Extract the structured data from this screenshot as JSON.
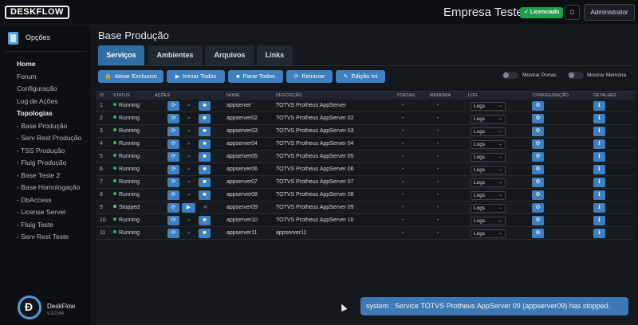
{
  "header": {
    "logo": "DESKFLOW",
    "company": "Empresa Teste",
    "license_badge": "✓ Licenciado",
    "user_button": "Administrator"
  },
  "sidebar": {
    "title": "Opções",
    "items": [
      {
        "label": "Home"
      },
      {
        "label": "Forum"
      },
      {
        "label": "Configuração"
      },
      {
        "label": "Log de Ações"
      },
      {
        "label": "Topologias"
      },
      {
        "label": "- Base Produção"
      },
      {
        "label": "- Serv Rest Produção"
      },
      {
        "label": "- TSS Produção"
      },
      {
        "label": "- Fluig Produção"
      },
      {
        "label": "- Base Teste 2"
      },
      {
        "label": "- Base Homologação"
      },
      {
        "label": "- DbAccess"
      },
      {
        "label": "- License Server"
      },
      {
        "label": "- Fluig Teste"
      },
      {
        "label": "- Serv Rest Teste"
      }
    ],
    "brand_name": "DeskFlow",
    "brand_version": "v.3.0.64"
  },
  "page": {
    "title": "Base Produção",
    "tabs": [
      "Serviços",
      "Ambientes",
      "Arquivos",
      "Links"
    ]
  },
  "actions": {
    "exclusive": "Ativar Exclusivo",
    "start_all": "Iniciar Todos",
    "stop_all": "Parar Todos",
    "restart": "Reiniciar",
    "edit_ini": "Edição Ini",
    "show_ports": "Mostrar Portas",
    "show_memory": "Mostrar Memória"
  },
  "table": {
    "headers": [
      "ID",
      "STATUS",
      "AÇÕES",
      "NOME",
      "DESCRIÇÃO",
      "PORTAS",
      "MEMÓRIA",
      "LOG",
      "CONFIGURAÇÃO",
      "DETALHES"
    ],
    "rows": [
      {
        "id": "1",
        "status": "Running",
        "name": "appserver",
        "desc": "TOTVS Protheus AppServer",
        "ports": "-",
        "memory": "-",
        "log": "Logs"
      },
      {
        "id": "2",
        "status": "Running",
        "name": "appserver02",
        "desc": "TOTVS Protheus AppServer 02",
        "ports": "-",
        "memory": "-",
        "log": "Logs"
      },
      {
        "id": "3",
        "status": "Running",
        "name": "appserver03",
        "desc": "TOTVS Protheus AppServer 03",
        "ports": "-",
        "memory": "-",
        "log": "Logs"
      },
      {
        "id": "4",
        "status": "Running",
        "name": "appserver04",
        "desc": "TOTVS Protheus AppServer 04",
        "ports": "-",
        "memory": "-",
        "log": "Logs"
      },
      {
        "id": "5",
        "status": "Running",
        "name": "appserver05",
        "desc": "TOTVS Protheus AppServer 05",
        "ports": "-",
        "memory": "-",
        "log": "Logs"
      },
      {
        "id": "6",
        "status": "Running",
        "name": "appserver06",
        "desc": "TOTVS Protheus AppServer 06",
        "ports": "-",
        "memory": "-",
        "log": "Logs"
      },
      {
        "id": "7",
        "status": "Running",
        "name": "appserver07",
        "desc": "TOTVS Protheus AppServer 07",
        "ports": "-",
        "memory": "-",
        "log": "Logs"
      },
      {
        "id": "8",
        "status": "Running",
        "name": "appserver08",
        "desc": "TOTVS Protheus AppServer 08",
        "ports": "-",
        "memory": "-",
        "log": "Logs"
      },
      {
        "id": "9",
        "status": "Stopped",
        "name": "appserver09",
        "desc": "TOTVS Protheus AppServer 09",
        "ports": "-",
        "memory": "-",
        "log": "Logs"
      },
      {
        "id": "10",
        "status": "Running",
        "name": "appserver10",
        "desc": "TOTVS Protheus AppServer 10",
        "ports": "-",
        "memory": "-",
        "log": "Logs"
      },
      {
        "id": "11",
        "status": "Running",
        "name": "appserver11",
        "desc": "appserver11",
        "ports": "-",
        "memory": "-",
        "log": "Logs"
      }
    ]
  },
  "toast": "system : Service TOTVS Protheus AppServer 09 (appserver09) has stopped.",
  "colors": {
    "accent": "#3d7fbf",
    "running": "#2fb463",
    "stopped": "#9aa3ad",
    "license": "#1f9d4b"
  }
}
